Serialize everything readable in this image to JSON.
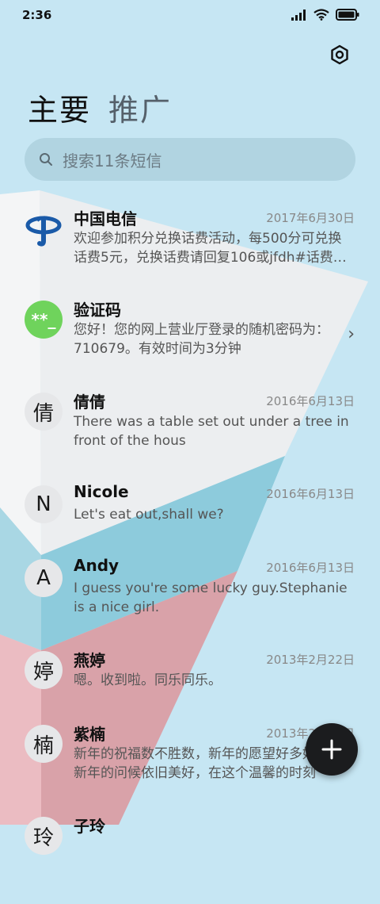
{
  "status": {
    "time": "2:36"
  },
  "tabs": [
    {
      "label": "主要"
    },
    {
      "label": "推广"
    }
  ],
  "search": {
    "placeholder": "搜索11条短信"
  },
  "messages": [
    {
      "name": "中国电信",
      "date": "2017年6月30日",
      "preview": "欢迎参加积分兑换话费活动，每500分可兑换话费5元，兑换话费请回复106或jfdh#话费…",
      "avatar_type": "logo"
    },
    {
      "name": "验证码",
      "date": "",
      "preview": "您好！您的网上营业厅登录的随机密码为：710679。有效时间为3分钟",
      "avatar_text": "**_",
      "avatar_color": "#6fd35c"
    },
    {
      "name": "倩倩",
      "date": "2016年6月13日",
      "preview": "There was a table set out under a tree in front of the hous",
      "avatar_text": "倩"
    },
    {
      "name": "Nicole",
      "date": "2016年6月13日",
      "preview": "Let's eat out,shall we?",
      "avatar_text": "N"
    },
    {
      "name": "Andy",
      "date": "2016年6月13日",
      "preview": "I guess you're some lucky guy.Stephanie is a nice girl.",
      "avatar_text": "A"
    },
    {
      "name": "燕婷",
      "date": "2013年2月22日",
      "preview": "嗯。收到啦。同乐同乐。",
      "avatar_text": "婷"
    },
    {
      "name": "紫楠",
      "date": "2013年2月22日",
      "preview": "新年的祝福数不胜数，新年的愿望好多好多，新年的问候依旧美好，在这个温馨的时刻",
      "avatar_text": "楠"
    },
    {
      "name": "子玲",
      "date": "",
      "preview": "",
      "avatar_text": "玲"
    }
  ],
  "colors": {
    "background": "#c6e6f3",
    "fab": "#1b1c1e",
    "telecom_blue": "#1a5aa8",
    "code_green": "#6fd35c"
  }
}
